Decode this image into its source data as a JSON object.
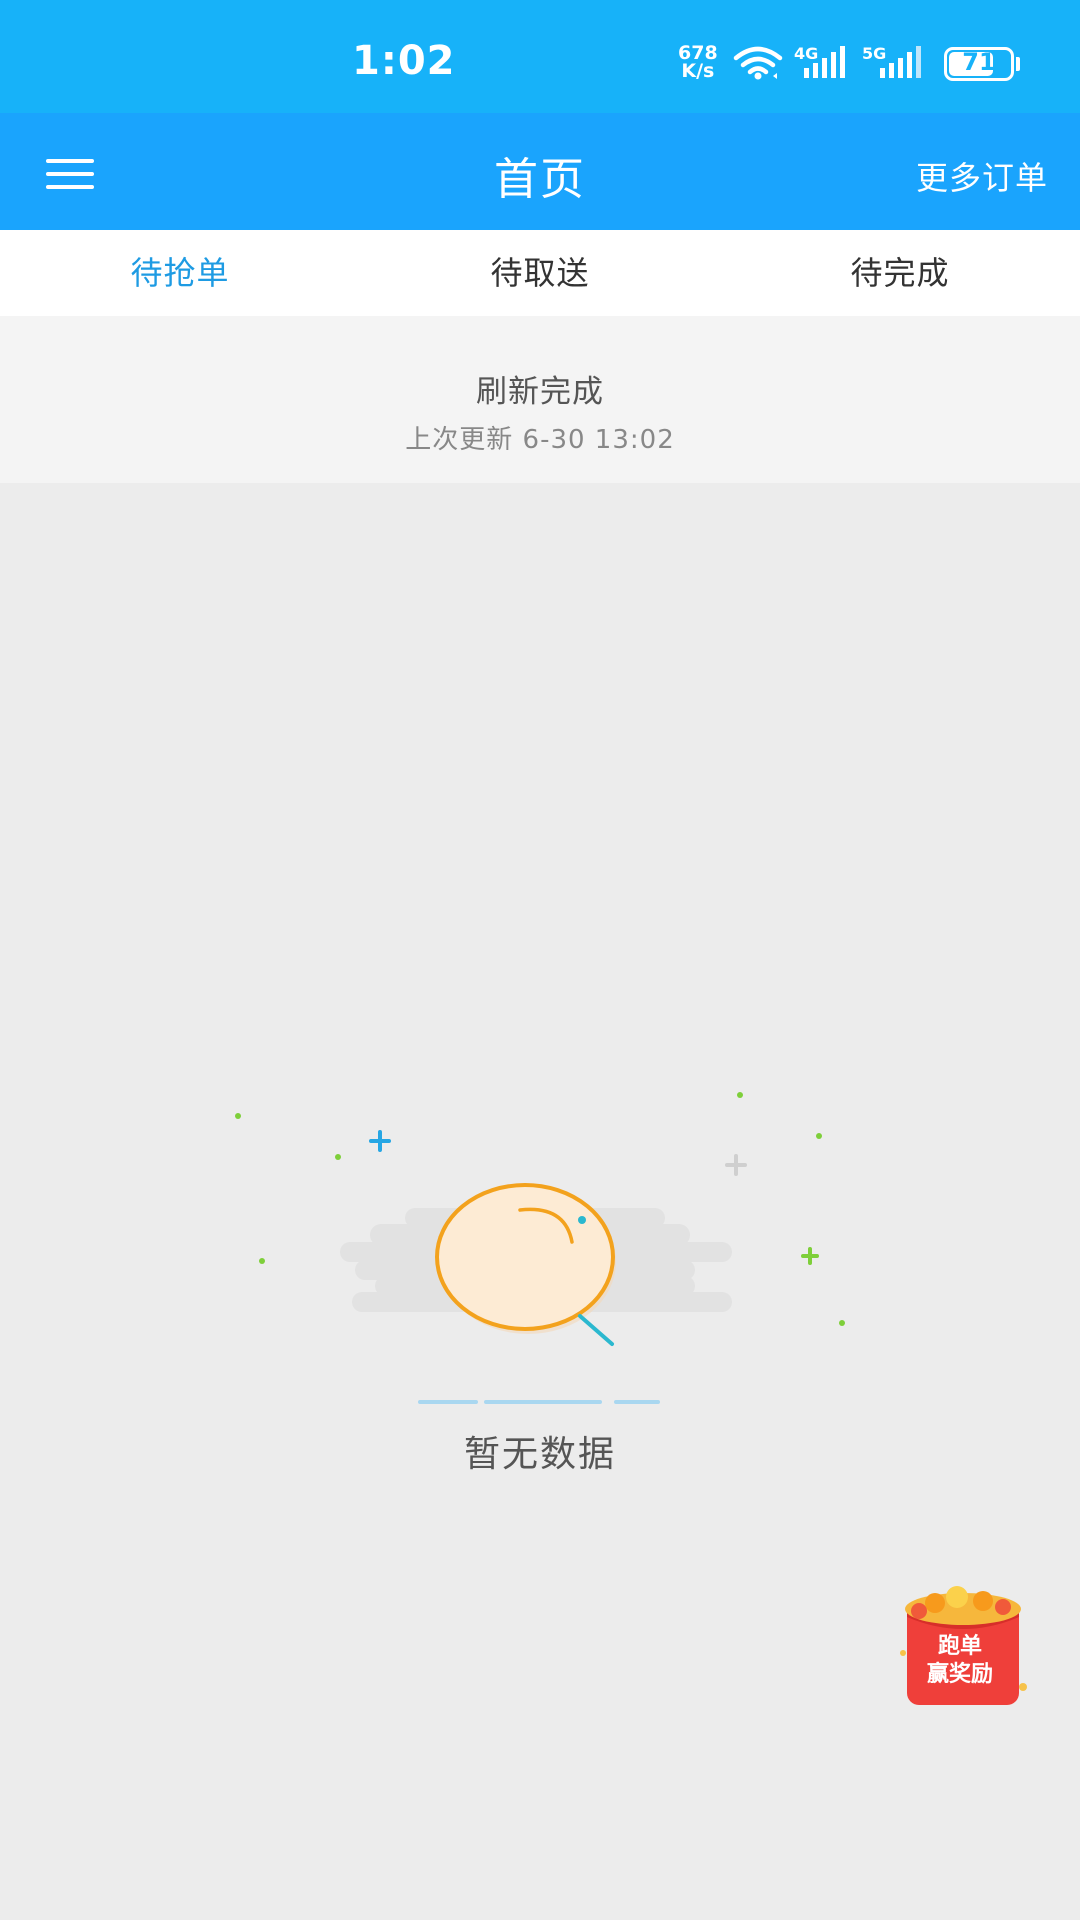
{
  "status_bar": {
    "time": "1:02",
    "speed_value": "678",
    "speed_unit": "K/s",
    "network_4g": "4G",
    "network_5g": "5G",
    "battery": "71",
    "background_color": "#17b2f9"
  },
  "header": {
    "title": "首页",
    "more_orders": "更多订单",
    "background_color": "#1aa4fd"
  },
  "tabs": [
    {
      "label": "待抢单",
      "active": true
    },
    {
      "label": "待取送",
      "active": false
    },
    {
      "label": "待完成",
      "active": false
    }
  ],
  "refresh": {
    "title": "刷新完成",
    "last_update": "上次更新 6-30 13:02"
  },
  "empty_state": {
    "message": "暂无数据"
  },
  "reward": {
    "line1": "跑单",
    "line2": "赢奖励"
  },
  "colors": {
    "active_tab": "#1e9be3",
    "page_background": "#ececec"
  }
}
